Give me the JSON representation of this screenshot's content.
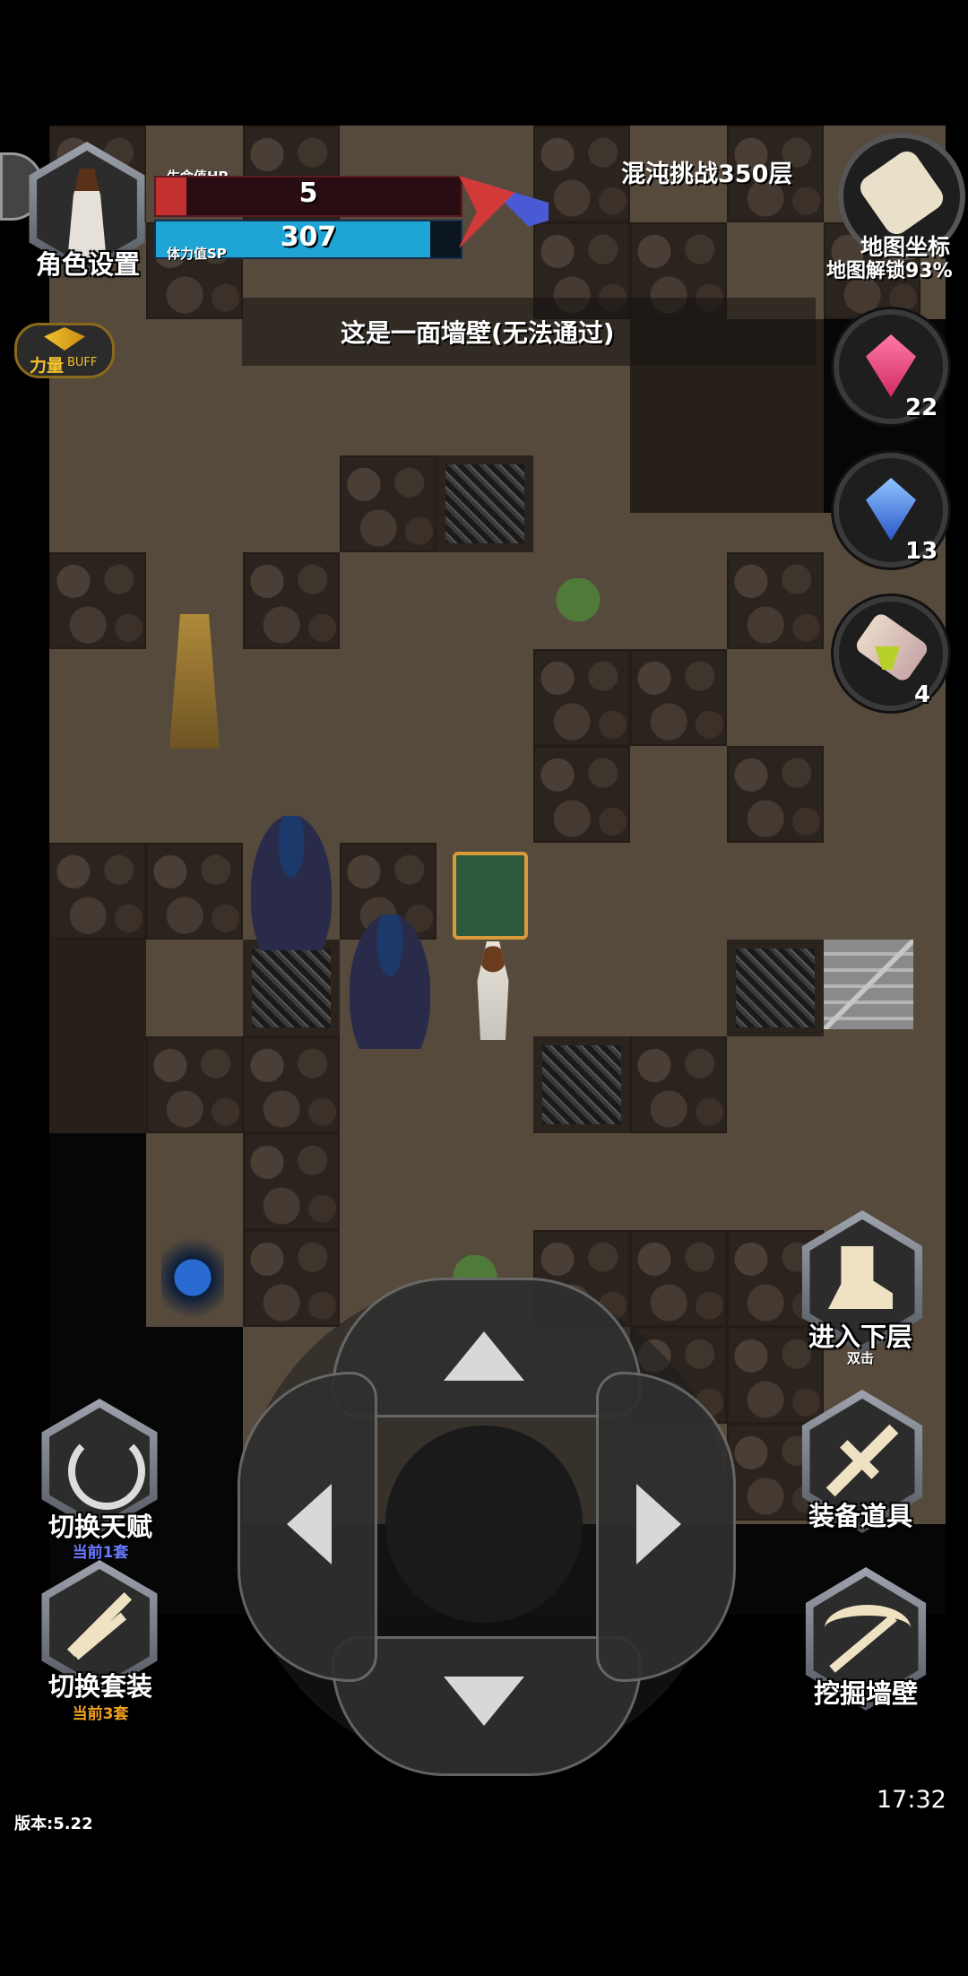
{
  "hud": {
    "character_settings": "角色设置",
    "hp_label": "生命值HP",
    "hp_value": "5",
    "hp_fraction": 0.1,
    "sp_label": "体力值SP",
    "sp_value": "307",
    "sp_fraction": 0.9,
    "buff_label": "力量",
    "buff_tag": "BUFF",
    "floor_title": "混沌挑战350层",
    "map_coords": "地图坐标",
    "map_unlock": "地图解锁93%",
    "message": "这是一面墙壁(无法通过)"
  },
  "items": {
    "red_potion_count": "22",
    "blue_potion_count": "13",
    "scroll_count": "4"
  },
  "actions": {
    "next_floor": "进入下层",
    "next_floor_hint": "双击",
    "equip": "装备道具",
    "dig_wall": "挖掘墙壁",
    "switch_talent": "切换天赋",
    "switch_talent_sub": "当前1套",
    "switch_set": "切换套装",
    "switch_set_sub": "当前3套"
  },
  "footer": {
    "version": "版本:5.22",
    "time": "17:32"
  },
  "colors": {
    "hp": "#c23030",
    "sp": "#1fa4d6",
    "talent_sub": "#6a7bff",
    "set_sub": "#f0a020"
  }
}
